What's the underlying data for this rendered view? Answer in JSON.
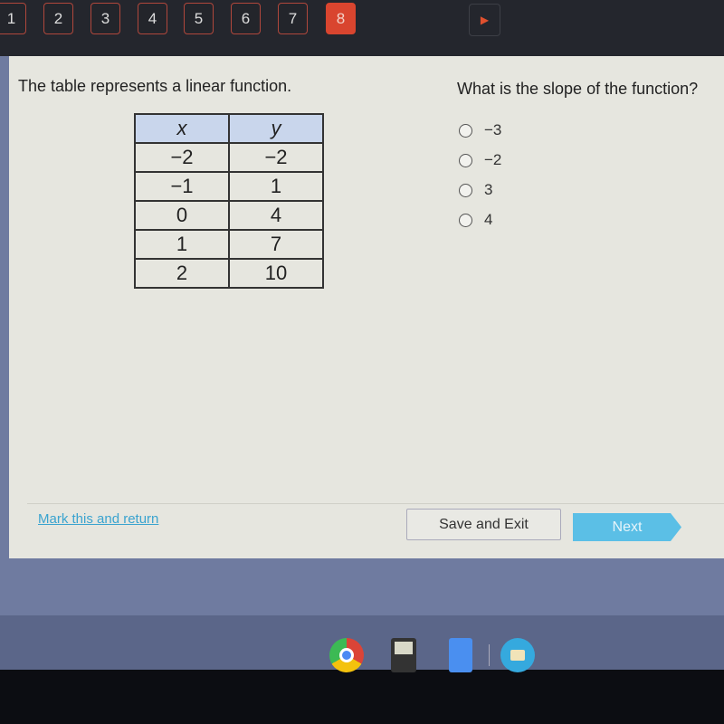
{
  "nav": {
    "questions": [
      "1",
      "2",
      "3",
      "4",
      "5",
      "6",
      "7",
      "8"
    ],
    "active": "8",
    "next_icon": "play-triangle-icon",
    "colors": {
      "active": "#d9452f",
      "border": "#b0473c"
    }
  },
  "main": {
    "prompt": "The table represents a linear function.",
    "table": {
      "headers": [
        "x",
        "y"
      ],
      "rows": [
        [
          "−2",
          "−2"
        ],
        [
          "−1",
          "1"
        ],
        [
          "0",
          "4"
        ],
        [
          "1",
          "7"
        ],
        [
          "2",
          "10"
        ]
      ]
    },
    "question": "What is the slope of the function?",
    "options": [
      "−3",
      "−2",
      "3",
      "4"
    ]
  },
  "footer": {
    "mark_link": "Mark this and return",
    "save_exit": "Save and Exit",
    "next": "Next",
    "accent": "#5bbfe6"
  },
  "shelf": {
    "apps": [
      "chrome-icon",
      "calculator-icon",
      "docs-icon",
      "files-icon"
    ]
  }
}
